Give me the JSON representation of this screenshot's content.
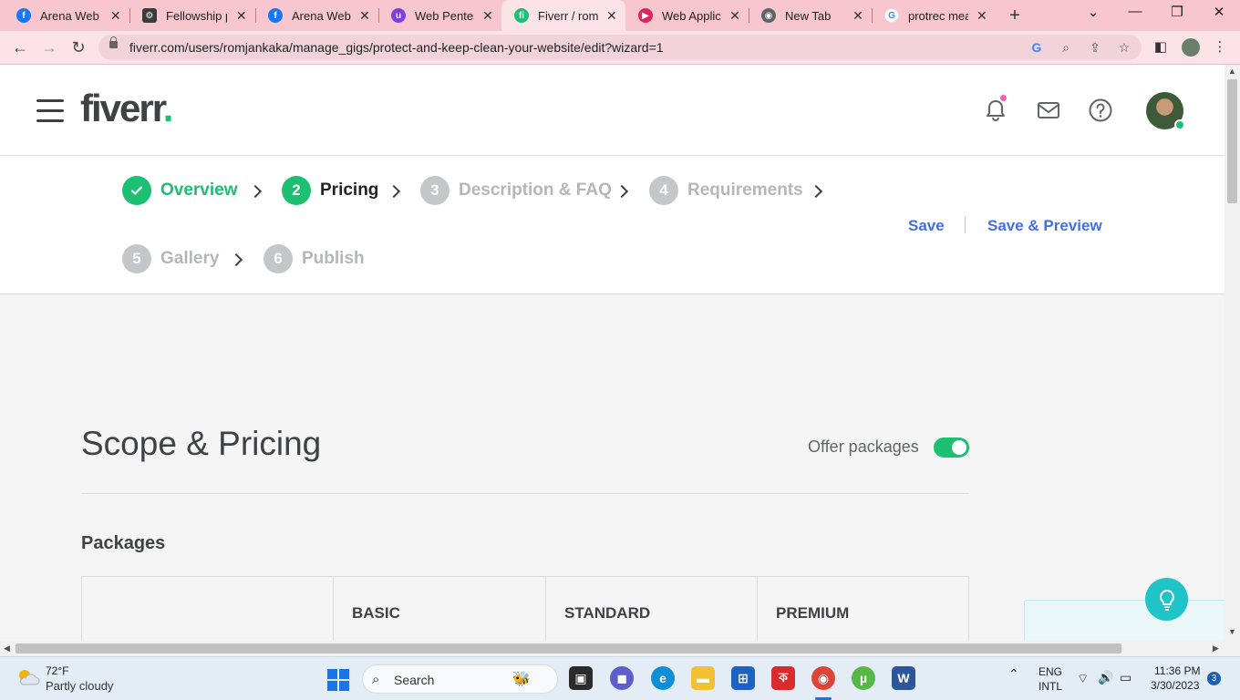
{
  "browser": {
    "tabs": [
      {
        "title": "Arena Web Se",
        "favicon": "facebook-icon",
        "color": "#1877f2",
        "active": false
      },
      {
        "title": "Fellowship pr",
        "favicon": "gear-badge-icon",
        "color": "#3c3c3c",
        "active": false
      },
      {
        "title": "Arena Web Se",
        "favicon": "facebook-icon",
        "color": "#1877f2",
        "active": false
      },
      {
        "title": "Web Pentesti",
        "favicon": "u-logo-icon",
        "color": "#7b3fe4",
        "active": false
      },
      {
        "title": "Fiverr / romja",
        "favicon": "fiverr-icon",
        "color": "#1dbf73",
        "active": true
      },
      {
        "title": "Web Applicat",
        "favicon": "play-icon",
        "color": "#e0245e",
        "active": false
      },
      {
        "title": "New Tab",
        "favicon": "chrome-icon",
        "color": "#5f6368",
        "active": false
      },
      {
        "title": "protrec mean",
        "favicon": "google-icon",
        "color": "#4285f4",
        "active": false
      }
    ],
    "url": "fiverr.com/users/romjankaka/manage_gigs/protect-and-keep-clean-your-website/edit?wizard=1"
  },
  "header": {
    "logo_text": "fiverr",
    "logo_dot": "."
  },
  "wizard": {
    "steps": [
      {
        "number": "",
        "label": "Overview",
        "state": "done"
      },
      {
        "number": "2",
        "label": "Pricing",
        "state": "current"
      },
      {
        "number": "3",
        "label": "Description & FAQ",
        "state": "todo"
      },
      {
        "number": "4",
        "label": "Requirements",
        "state": "todo"
      },
      {
        "number": "5",
        "label": "Gallery",
        "state": "todo"
      },
      {
        "number": "6",
        "label": "Publish",
        "state": "todo"
      }
    ],
    "save_label": "Save",
    "save_preview_label": "Save & Preview"
  },
  "content": {
    "title": "Scope & Pricing",
    "offer_packages_label": "Offer packages",
    "offer_packages_on": true,
    "packages_title": "Packages",
    "package_columns": [
      "BASIC",
      "STANDARD",
      "PREMIUM"
    ]
  },
  "taskbar": {
    "weather_temp": "72°F",
    "weather_desc": "Partly cloudy",
    "search_label": "Search",
    "lang_top": "ENG",
    "lang_bottom": "INTL",
    "time": "11:36 PM",
    "date": "3/30/2023",
    "notification_count": "3"
  },
  "colors": {
    "brand_green": "#1dbf73",
    "link_blue": "#446ee7",
    "tab_strip": "#f7c6cf"
  }
}
